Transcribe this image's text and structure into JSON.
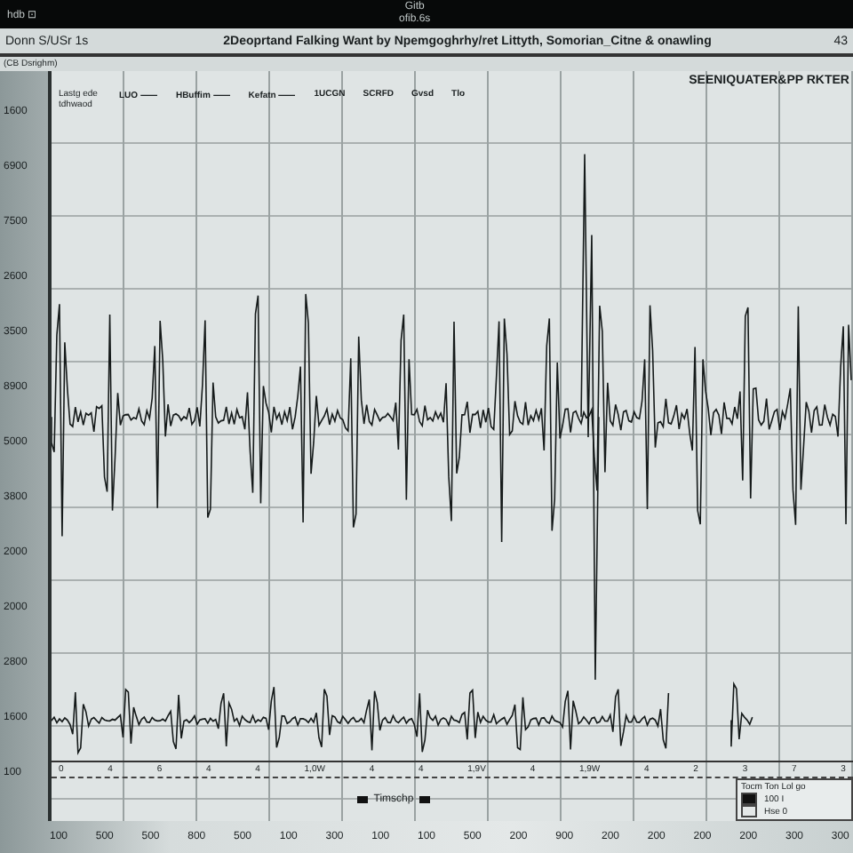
{
  "top_bar": {
    "left": "hdb ⊡",
    "title": "Gitb",
    "subtitle": "ofib.6s"
  },
  "window": {
    "app": "Donn S/USr 1s",
    "title": "2Deoprtand Falking Want by Npemgoghrhy/ret Littyth, Somorian_Citne & onawling",
    "badge": "43"
  },
  "panel_label": "(CB Dsrighm)",
  "chart": {
    "heading": "SEENIQUATER&PP RKTER",
    "header_labels": [
      "Lastg ede tdhwaod",
      "LUO ⸺",
      "HBuffim ⸺",
      "Kefatn ⸺",
      "1UCGN",
      "SCRFD",
      "Gvsd",
      "Tlo"
    ],
    "y_labels": [
      "1600",
      "6900",
      "7500",
      "2600",
      "3500",
      "8900",
      "5000",
      "3800",
      "2000",
      "2000",
      "2800",
      "1600",
      "100"
    ],
    "x_labels": [
      "0",
      "4",
      "6",
      "4",
      "4",
      "1,0W",
      "4",
      "4",
      "1,9V",
      "4",
      "1,9W",
      "4",
      "2",
      "3",
      "7",
      "3"
    ],
    "scale_label": "Timschp",
    "legend": {
      "title": "Tocm Ton Lol go",
      "items": [
        {
          "label": "100 I",
          "color": "#111111"
        },
        {
          "label": "Hse 0",
          "color": "#e4e8e8"
        }
      ]
    }
  },
  "bottom_numbers": [
    "100",
    "500",
    "500",
    "800",
    "500",
    "100",
    "300",
    "100",
    "100",
    "500",
    "200",
    "900",
    "200",
    "200",
    "200",
    "200",
    "300",
    "300"
  ]
}
